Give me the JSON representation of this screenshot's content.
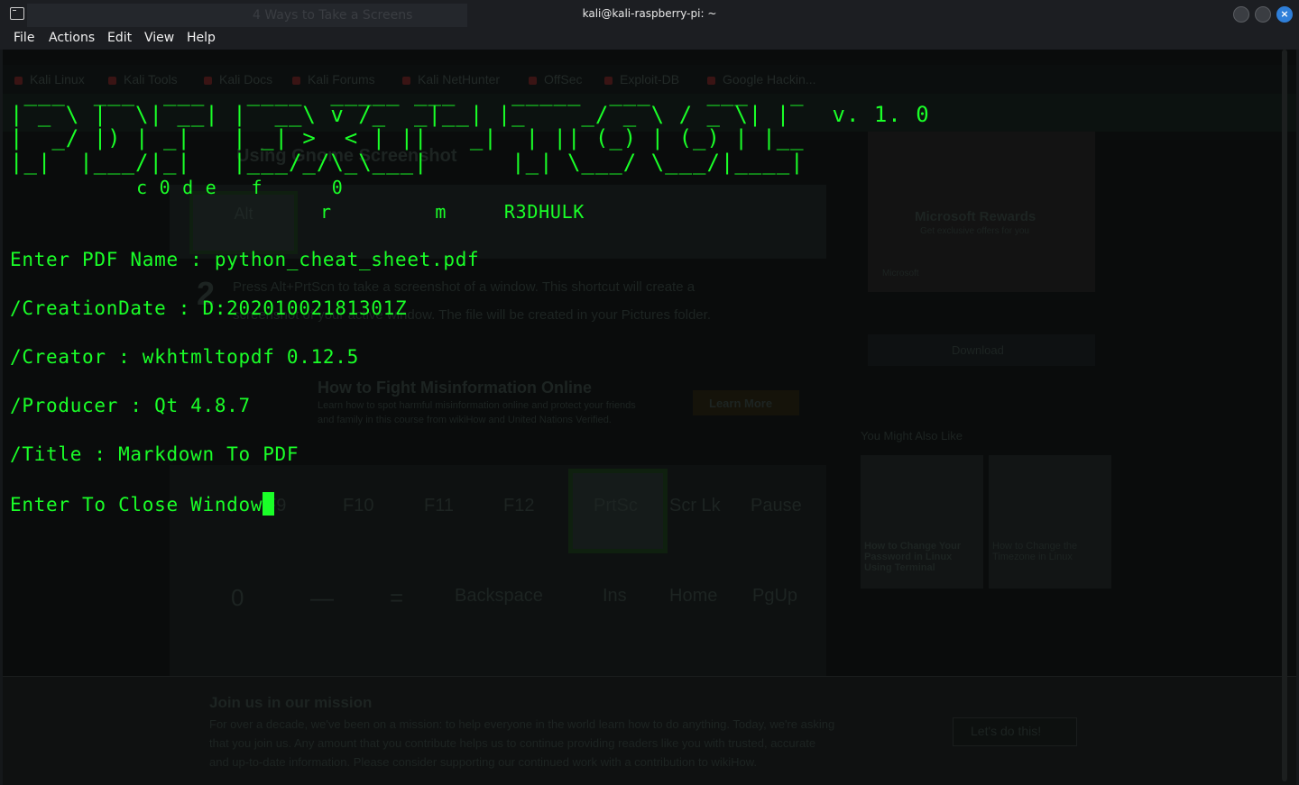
{
  "window": {
    "title": "kali@kali-raspberry-pi: ~",
    "ghost_tabs": [
      "",
      "4 Ways to Take a Screens"
    ],
    "close_glyph": "×"
  },
  "menu": [
    "File",
    "Actions",
    "Edit",
    "View",
    "Help"
  ],
  "background_page": {
    "bookmarks": [
      "Kali Linux",
      "Kali Tools",
      "Kali Docs",
      "Kali Forums",
      "Kali NetHunter",
      "OffSec",
      "Exploit-DB",
      "Google Hackin..."
    ],
    "heading": "Using Gnome Screenshot",
    "step_number": "2",
    "step_text_line1": "Press  Alt+PrtScn  to take a screenshot of a window. This shortcut will create a",
    "step_text_line2": "screenshot of your active window. The file will be created in your Pictures folder.",
    "ad_title": "How to Fight Misinformation Online",
    "ad_text_line1": "Learn how to spot harmful misinformation online and protect your friends",
    "ad_text_line2": "and family in this course from wikiHow and United Nations Verified.",
    "ad_button": "Learn More",
    "keys_row1": [
      "Alt",
      "",
      "",
      "",
      ""
    ],
    "keys_row2": [
      "F9",
      "F10",
      "F11",
      "F12",
      "PrtSc",
      "Scr Lk",
      "Pause"
    ],
    "keys_row3": [
      "0",
      "—",
      "=",
      "Backspace",
      "Ins",
      "Home",
      "PgUp"
    ],
    "sidebar_ad_title": "Microsoft Rewards",
    "sidebar_ad_sub": "Get exclusive offers for you",
    "sidebar_ad_brand": "Microsoft",
    "sidebar_download": "Download",
    "you_might_like": "You Might Also Like",
    "related_1": "How to Change Your Password in Linux Using Terminal",
    "related_2": "How to Change the Timezone in Linux",
    "banner_title": "Join us in our mission",
    "banner_text_1": "For over a decade, we've been on a mission: to help everyone in the world learn how to do anything. Today, we're asking",
    "banner_text_2": "that you join us. Any amount that you contribute helps us to continue providing readers like you with trusted, accurate",
    "banner_text_3": "and up-to-date information. Please consider supporting our continued work with a contribution to wikiHow.",
    "banner_button": "Let's do this!"
  },
  "terminal": {
    "banner_line1": " ___  ___  ___   ____  _____ ___    _____  ___    ___   _",
    "banner_line2": "| _ \\ |  \\| __| |  __\\ v /_  _|__| |_    _/ _ \\ / _ \\| |   v. 1. 0",
    "banner_line3": "|  _/ |) | _|   | _| >  < | ||   _|  | || (_) | (_) | |__",
    "banner_line4": "|_|  |___/|_|   |___/_/\\_\\___|      |_| \\___/ \\___/|____|",
    "credit_line1": "           c 0 d e   f      0",
    "credit_line2": "                           r         m     R3DHULK",
    "lines": [
      "Enter PDF Name : python_cheat_sheet.pdf",
      "/CreationDate : D:20201002181301Z",
      "/Creator : wkhtmltopdf 0.12.5",
      "/Producer : Qt 4.8.7",
      "/Title : Markdown To PDF",
      "Enter To Close Window"
    ]
  },
  "colors": {
    "terminal_text": "#1aff28",
    "titlebar_bg": "#1c1e22",
    "close_button": "#2f7fd9"
  }
}
